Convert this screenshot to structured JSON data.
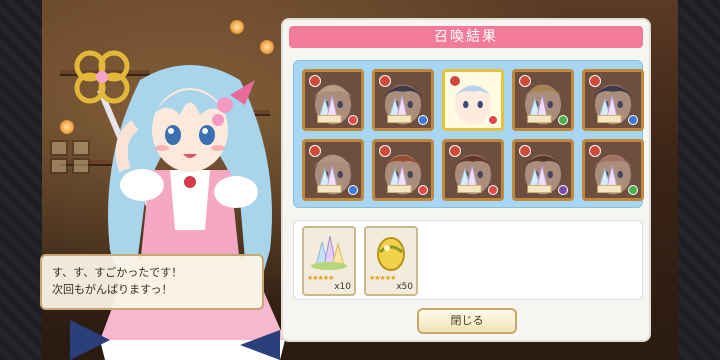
{
  "panel": {
    "title": "召喚結果",
    "close_label": "閉じる"
  },
  "speech": {
    "line1": "す、す、すごかったです！",
    "line2": "次回もがんばりますっ！"
  },
  "results": [
    {
      "name": "card-1",
      "element": "fire",
      "rarity": "normal"
    },
    {
      "name": "card-2",
      "element": "water",
      "rarity": "normal"
    },
    {
      "name": "card-3",
      "element": "fire",
      "rarity": "rare"
    },
    {
      "name": "card-4",
      "element": "wind",
      "rarity": "normal"
    },
    {
      "name": "card-5",
      "element": "water",
      "rarity": "normal"
    },
    {
      "name": "card-6",
      "element": "water",
      "rarity": "normal"
    },
    {
      "name": "card-7",
      "element": "fire",
      "rarity": "normal"
    },
    {
      "name": "card-8",
      "element": "fire",
      "rarity": "normal"
    },
    {
      "name": "card-9",
      "element": "dark",
      "rarity": "normal"
    },
    {
      "name": "card-10",
      "element": "wind",
      "rarity": "normal"
    }
  ],
  "items": [
    {
      "icon": "crystal-cluster-icon",
      "stars": "★★★★★",
      "quantity": "x10"
    },
    {
      "icon": "golden-egg-icon",
      "stars": "★★★★★",
      "quantity": "x50"
    }
  ],
  "colors": {
    "title_bar": "#f27b9a",
    "results_bg": "#a8d6f2",
    "rare_border": "#e6c43a",
    "normal_border": "#c0883a"
  }
}
